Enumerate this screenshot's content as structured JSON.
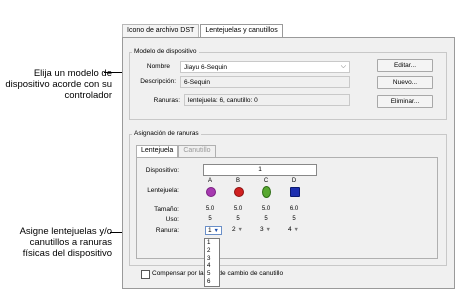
{
  "callouts": {
    "top": "Elija un modelo de dispositivo acorde con su controlador",
    "bottom": "Asigne lentejuelas y/o canutillos a ranuras físicas del dispositivo"
  },
  "tabs": [
    "Icono de archivo DST",
    "Lentejuelas y canutillos"
  ],
  "device_model": {
    "group_title": "Modelo de dispositivo",
    "name_label": "Nombre",
    "name_value": "Jiayu 6-Sequin",
    "desc_label": "Descripción:",
    "desc_value": "6-Sequin",
    "slots_label": "Ranuras:",
    "slots_value": "lentejuela: 6, canutillo: 0",
    "buttons": [
      "Editar...",
      "Nuevo...",
      "Eliminar..."
    ]
  },
  "slot_assignment": {
    "group_title": "Asignación de ranuras",
    "tabs": [
      "Lentejuela",
      "Canutillo"
    ],
    "labels": {
      "device": "Dispositivo:",
      "sequin": "Lentejuela:",
      "size": "Tamaño:",
      "uses": "Uso:",
      "slot": "Ranura:"
    },
    "device_number": "1",
    "columns": [
      {
        "letter": "A",
        "color": "#a63ab0",
        "size": "5.0",
        "uses": "5",
        "slot": "1"
      },
      {
        "letter": "B",
        "color": "#d02020",
        "size": "5.0",
        "uses": "5",
        "slot": "2"
      },
      {
        "letter": "C",
        "color": "#58a830",
        "size": "5.0",
        "uses": "5",
        "slot": "3"
      },
      {
        "letter": "D",
        "color": "#1d2fb0",
        "size": "6.0",
        "uses": "5",
        "slot": "4"
      }
    ],
    "dropdown_options": [
      "1",
      "2",
      "3",
      "4",
      "5",
      "6"
    ]
  },
  "compensate": {
    "label_part1": "Compensar por la",
    "label_part2": "a de cambio de canutillo"
  }
}
